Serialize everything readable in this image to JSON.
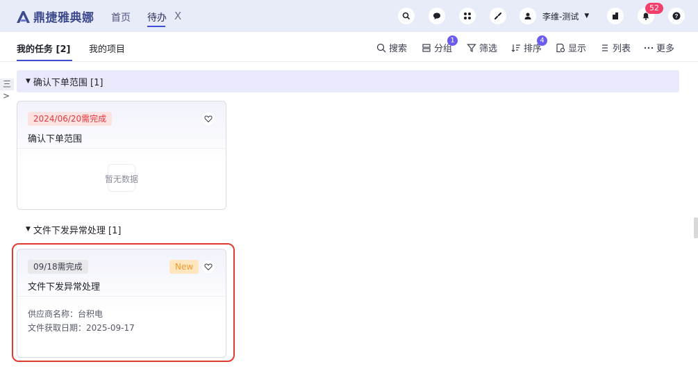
{
  "header": {
    "logo_text": "鼎捷雅典娜",
    "nav_home": "首页",
    "nav_tab": "待办",
    "nav_tab_close": "X",
    "icons": [
      "search-icon",
      "chat-icon",
      "apps-icon",
      "link-icon",
      "user-icon",
      "building-icon",
      "bell-icon",
      "help-icon"
    ],
    "user_name": "李维-测试",
    "notification_count": "52",
    "accent_color": "#3e4fd6"
  },
  "subtabs": {
    "my_tasks": "我的任务 [2]",
    "my_projects": "我的项目"
  },
  "toolbar": {
    "search": "搜索",
    "group": "分组",
    "group_badge": "1",
    "filter": "筛选",
    "sort": "排序",
    "sort_badge": "4",
    "display": "显示",
    "list": "列表",
    "more": "更多"
  },
  "side_toggle": "三>",
  "groups": [
    {
      "header": "确认下单范围 [1]",
      "card": {
        "due": "2024/06/20需完成",
        "title": "确认下单范围",
        "empty_text": "暂无数据"
      }
    },
    {
      "header": "文件下发异常处理 [1]",
      "card": {
        "due": "09/18需完成",
        "tag": "New",
        "title": "文件下发异常处理",
        "fields": [
          "供应商名称：台积电",
          "文件获取日期：2025-09-17"
        ]
      }
    }
  ]
}
